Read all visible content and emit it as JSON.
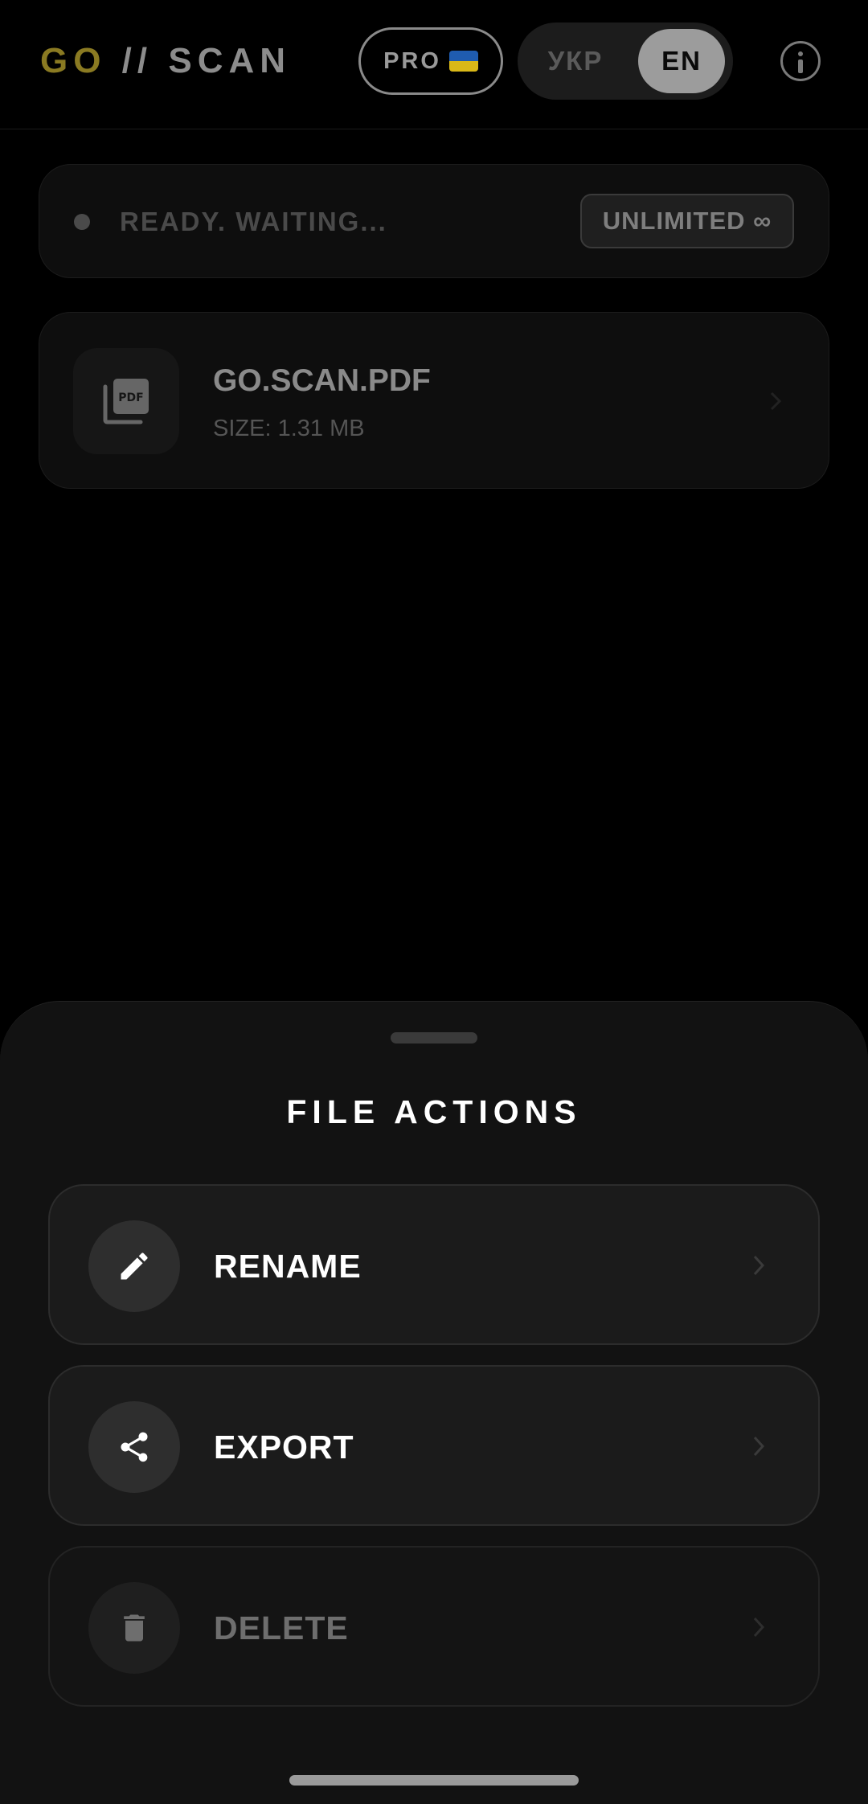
{
  "header": {
    "logo_go": "GO",
    "logo_rest": " // SCAN",
    "pro_label": "PRO",
    "lang_options": [
      "УКР",
      "EN"
    ],
    "lang_selected": "EN",
    "info_icon": "info-icon"
  },
  "status": {
    "text": "READY. WAITING...",
    "badge": "UNLIMITED ∞"
  },
  "file": {
    "name": "GO.SCAN.PDF",
    "size": "SIZE: 1.31 MB",
    "icon": "pdf-icon"
  },
  "sheet": {
    "title": "FILE ACTIONS",
    "actions": [
      {
        "label": "RENAME",
        "icon": "pencil-icon"
      },
      {
        "label": "EXPORT",
        "icon": "share-icon"
      },
      {
        "label": "DELETE",
        "icon": "trash-icon"
      }
    ]
  },
  "colors": {
    "background": "#000000",
    "accent": "#8a7a22",
    "sheet": "#121212",
    "flag_blue": "#1f5cb0",
    "flag_yellow": "#d9b818"
  }
}
